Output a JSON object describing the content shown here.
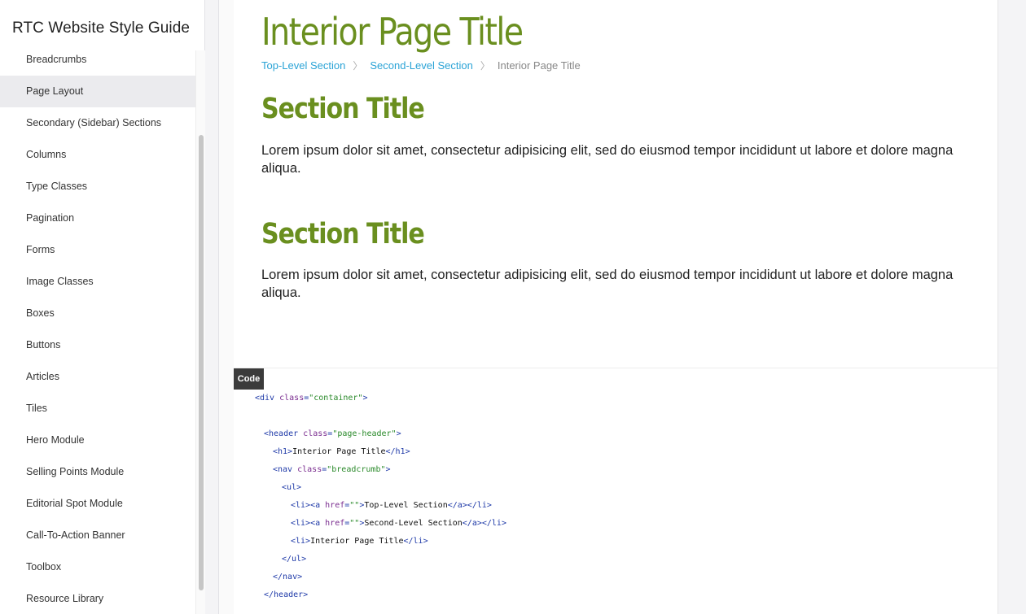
{
  "sidebar": {
    "title": "RTC Website Style Guide",
    "items": [
      {
        "label": "Breadcrumbs",
        "active": false
      },
      {
        "label": "Page Layout",
        "active": true
      },
      {
        "label": "Secondary (Sidebar) Sections",
        "active": false
      },
      {
        "label": "Columns",
        "active": false
      },
      {
        "label": "Type Classes",
        "active": false
      },
      {
        "label": "Pagination",
        "active": false
      },
      {
        "label": "Forms",
        "active": false
      },
      {
        "label": "Image Classes",
        "active": false
      },
      {
        "label": "Boxes",
        "active": false
      },
      {
        "label": "Buttons",
        "active": false
      },
      {
        "label": "Articles",
        "active": false
      },
      {
        "label": "Tiles",
        "active": false
      },
      {
        "label": "Hero Module",
        "active": false
      },
      {
        "label": "Selling Points Module",
        "active": false
      },
      {
        "label": "Editorial Spot Module",
        "active": false
      },
      {
        "label": "Call-To-Action Banner",
        "active": false
      },
      {
        "label": "Toolbox",
        "active": false
      },
      {
        "label": "Resource Library",
        "active": false
      }
    ]
  },
  "main": {
    "page_title": "Interior Page Title",
    "breadcrumb": {
      "level1": "Top-Level Section",
      "level2": "Second-Level Section",
      "current": "Interior Page Title",
      "separator": "〉"
    },
    "sections": [
      {
        "title": "Section Title",
        "text": "Lorem ipsum dolor sit amet, consectetur adipisicing elit, sed do eiusmod tempor incididunt ut labore et dolore magna aliqua."
      },
      {
        "title": "Section Title",
        "text": "Lorem ipsum dolor sit amet, consectetur adipisicing elit, sed do eiusmod tempor incididunt ut labore et dolore magna aliqua."
      }
    ]
  },
  "code": {
    "badge": "Code",
    "lines": [
      {
        "indent": 0,
        "parts": [
          [
            "tag",
            "<div "
          ],
          [
            "attr",
            "class"
          ],
          [
            "tag",
            "="
          ],
          [
            "val",
            "\"container\""
          ],
          [
            "tag",
            ">"
          ]
        ]
      },
      {
        "indent": 0,
        "parts": []
      },
      {
        "indent": 1,
        "parts": [
          [
            "tag",
            "<header "
          ],
          [
            "attr",
            "class"
          ],
          [
            "tag",
            "="
          ],
          [
            "val",
            "\"page-header\""
          ],
          [
            "tag",
            ">"
          ]
        ]
      },
      {
        "indent": 2,
        "parts": [
          [
            "tag",
            "<h1>"
          ],
          [
            "txt",
            "Interior Page Title"
          ],
          [
            "tag",
            "</h1>"
          ]
        ]
      },
      {
        "indent": 2,
        "parts": [
          [
            "tag",
            "<nav "
          ],
          [
            "attr",
            "class"
          ],
          [
            "tag",
            "="
          ],
          [
            "val",
            "\"breadcrumb\""
          ],
          [
            "tag",
            ">"
          ]
        ]
      },
      {
        "indent": 3,
        "parts": [
          [
            "tag",
            "<ul>"
          ]
        ]
      },
      {
        "indent": 4,
        "parts": [
          [
            "tag",
            "<li><a "
          ],
          [
            "attr",
            "href"
          ],
          [
            "tag",
            "="
          ],
          [
            "val",
            "\"\""
          ],
          [
            "tag",
            ">"
          ],
          [
            "txt",
            "Top-Level Section"
          ],
          [
            "tag",
            "</a></li>"
          ]
        ]
      },
      {
        "indent": 4,
        "parts": [
          [
            "tag",
            "<li><a "
          ],
          [
            "attr",
            "href"
          ],
          [
            "tag",
            "="
          ],
          [
            "val",
            "\"\""
          ],
          [
            "tag",
            ">"
          ],
          [
            "txt",
            "Second-Level Section"
          ],
          [
            "tag",
            "</a></li>"
          ]
        ]
      },
      {
        "indent": 4,
        "parts": [
          [
            "tag",
            "<li>"
          ],
          [
            "txt",
            "Interior Page Title"
          ],
          [
            "tag",
            "</li>"
          ]
        ]
      },
      {
        "indent": 3,
        "parts": [
          [
            "tag",
            "</ul>"
          ]
        ]
      },
      {
        "indent": 2,
        "parts": [
          [
            "tag",
            "</nav>"
          ]
        ]
      },
      {
        "indent": 1,
        "parts": [
          [
            "tag",
            "</header>"
          ]
        ]
      }
    ]
  }
}
